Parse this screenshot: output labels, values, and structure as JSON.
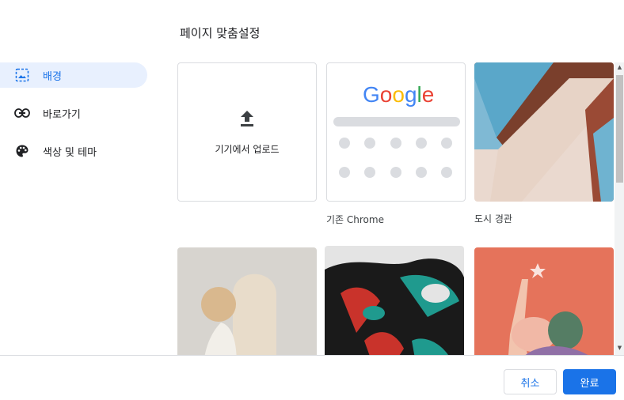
{
  "dialog": {
    "title": "페이지 맞춤설정"
  },
  "sidebar": {
    "items": [
      {
        "label": "배경",
        "icon": "background-image-icon",
        "active": true
      },
      {
        "label": "바로가기",
        "icon": "link-icon",
        "active": false
      },
      {
        "label": "색상 및 테마",
        "icon": "palette-icon",
        "active": false
      }
    ]
  },
  "tiles": {
    "upload": {
      "label": "기기에서 업로드",
      "icon": "upload-icon"
    },
    "classic": {
      "caption": "기존 Chrome",
      "logo": [
        "G",
        "o",
        "o",
        "g",
        "l",
        "e"
      ]
    },
    "cityscape": {
      "caption": "도시 경관"
    }
  },
  "footer": {
    "cancel_label": "취소",
    "done_label": "완료"
  },
  "colors": {
    "accent": "#1a73e8",
    "active_nav_bg": "#e8f0fe",
    "border": "#dadce0"
  }
}
